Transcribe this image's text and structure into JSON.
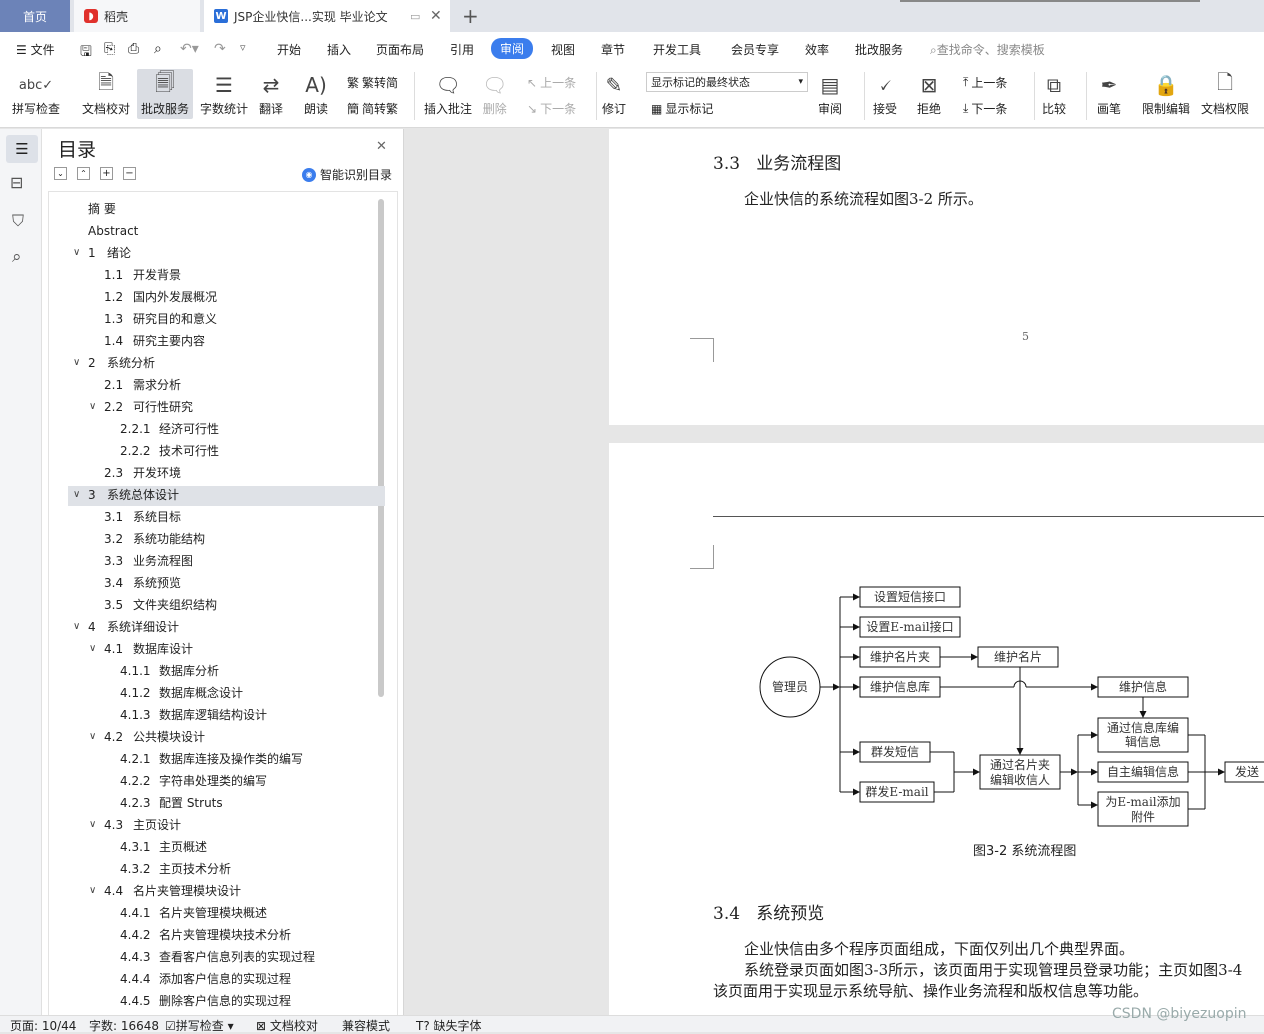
{
  "tabs": {
    "home": "首页",
    "wps": "稻壳",
    "doc": "JSP企业快信...实现 毕业论文"
  },
  "menu": {
    "file": "文件",
    "items": [
      "开始",
      "插入",
      "页面布局",
      "引用",
      "审阅",
      "视图",
      "章节",
      "开发工具",
      "会员专享",
      "效率",
      "批改服务"
    ],
    "active": "审阅",
    "search": "查找命令、搜索模板"
  },
  "ribbon": {
    "spellcheck": "拼写检查",
    "doc_check": "文档校对",
    "review_service": "批改服务",
    "word_count": "字数统计",
    "translate": "翻译",
    "read_aloud": "朗读",
    "trad_to_simp": "繁转简",
    "simp_to_trad": "简转繁",
    "insert_comment": "插入批注",
    "delete": "删除",
    "prev": "上一条",
    "next": "下一条",
    "revise": "修订",
    "markup_state": "显示标记的最终状态",
    "show_markup": "显示标记",
    "review": "审阅",
    "accept": "接受",
    "reject": "拒绝",
    "prev2": "上一条",
    "next2": "下一条",
    "compare": "比较",
    "pen": "画笔",
    "restrict_edit": "限制编辑",
    "doc_permission": "文档权限"
  },
  "nav": {
    "title": "目录",
    "smart_toc": "智能识别目录",
    "items": [
      {
        "num": "",
        "text": "摘  要",
        "level": 0,
        "expand": ""
      },
      {
        "num": "",
        "text": "Abstract",
        "level": 0,
        "expand": ""
      },
      {
        "num": "1",
        "text": "绪论",
        "level": 1,
        "expand": "v"
      },
      {
        "num": "1.1",
        "text": "开发背景",
        "level": 2,
        "expand": ""
      },
      {
        "num": "1.2",
        "text": "国内外发展概况",
        "level": 2,
        "expand": ""
      },
      {
        "num": "1.3",
        "text": "研究目的和意义",
        "level": 2,
        "expand": ""
      },
      {
        "num": "1.4",
        "text": "研究主要内容",
        "level": 2,
        "expand": ""
      },
      {
        "num": "2",
        "text": "系统分析",
        "level": 1,
        "expand": "v"
      },
      {
        "num": "2.1",
        "text": "需求分析",
        "level": 2,
        "expand": ""
      },
      {
        "num": "2.2",
        "text": "可行性研究",
        "level": 2,
        "expand": "v"
      },
      {
        "num": "2.2.1",
        "text": "经济可行性",
        "level": 3,
        "expand": ""
      },
      {
        "num": "2.2.2",
        "text": "技术可行性",
        "level": 3,
        "expand": ""
      },
      {
        "num": "2.3",
        "text": "开发环境",
        "level": 2,
        "expand": ""
      },
      {
        "num": "3",
        "text": "系统总体设计",
        "level": 1,
        "expand": "v",
        "selected": true
      },
      {
        "num": "3.1",
        "text": "系统目标",
        "level": 2,
        "expand": ""
      },
      {
        "num": "3.2",
        "text": "系统功能结构",
        "level": 2,
        "expand": ""
      },
      {
        "num": "3.3",
        "text": "业务流程图",
        "level": 2,
        "expand": ""
      },
      {
        "num": "3.4",
        "text": "系统预览",
        "level": 2,
        "expand": ""
      },
      {
        "num": "3.5",
        "text": "文件夹组织结构",
        "level": 2,
        "expand": ""
      },
      {
        "num": "4",
        "text": "系统详细设计",
        "level": 1,
        "expand": "v"
      },
      {
        "num": "4.1",
        "text": "数据库设计",
        "level": 2,
        "expand": "v"
      },
      {
        "num": "4.1.1",
        "text": "数据库分析",
        "level": 3,
        "expand": ""
      },
      {
        "num": "4.1.2",
        "text": "数据库概念设计",
        "level": 3,
        "expand": ""
      },
      {
        "num": "4.1.3",
        "text": "数据库逻辑结构设计",
        "level": 3,
        "expand": ""
      },
      {
        "num": "4.2",
        "text": "公共模块设计",
        "level": 2,
        "expand": "v"
      },
      {
        "num": "4.2.1",
        "text": "数据库连接及操作类的编写",
        "level": 3,
        "expand": ""
      },
      {
        "num": "4.2.2",
        "text": "字符串处理类的编写",
        "level": 3,
        "expand": ""
      },
      {
        "num": "4.2.3",
        "text": "配置 Struts",
        "level": 3,
        "expand": ""
      },
      {
        "num": "4.3",
        "text": "主页设计",
        "level": 2,
        "expand": "v"
      },
      {
        "num": "4.3.1",
        "text": "主页概述",
        "level": 3,
        "expand": ""
      },
      {
        "num": "4.3.2",
        "text": "主页技术分析",
        "level": 3,
        "expand": ""
      },
      {
        "num": "4.4",
        "text": "名片夹管理模块设计",
        "level": 2,
        "expand": "v"
      },
      {
        "num": "4.4.1",
        "text": "名片夹管理模块概述",
        "level": 3,
        "expand": ""
      },
      {
        "num": "4.4.2",
        "text": "名片夹管理模块技术分析",
        "level": 3,
        "expand": ""
      },
      {
        "num": "4.4.3",
        "text": "查看客户信息列表的实现过程",
        "level": 3,
        "expand": ""
      },
      {
        "num": "4.4.4",
        "text": "添加客户信息的实现过程",
        "level": 3,
        "expand": ""
      },
      {
        "num": "4.4.5",
        "text": "删除客户信息的实现过程",
        "level": 3,
        "expand": ""
      }
    ]
  },
  "document": {
    "sec33_num": "3.3",
    "sec33_title": "业务流程图",
    "sec33_body": "企业快信的系统流程如图3-2 所示。",
    "page_number": "5",
    "fig_caption": "图3-2  系统流程图",
    "sec34_num": "3.4",
    "sec34_title": "系统预览",
    "sec34_p1": "企业快信由多个程序页面组成，下面仅列出几个典型界面。",
    "sec34_p2": "系统登录页面如图3-3所示，该页面用于实现管理员登录功能；主页如图3-4",
    "sec34_p3": "该页面用于实现显示系统导航、操作业务流程和版权信息等功能。",
    "flow": {
      "admin": "管理员",
      "set_sms": "设置短信接口",
      "set_email": "设置E-mail接口",
      "maintain_folder": "维护名片夹",
      "maintain_card": "维护名片",
      "maintain_lib": "维护信息库",
      "maintain_info": "维护信息",
      "via_lib_1": "通过信息库编",
      "via_lib_2": "辑信息",
      "group_sms": "群发短信",
      "edit_recv_1": "通过名片夹",
      "edit_recv_2": "编辑收信人",
      "self_edit": "自主编辑信息",
      "group_email": "群发E-mail",
      "attach_1": "为E-mail添加",
      "attach_2": "附件",
      "send": "发送"
    }
  },
  "status": {
    "page": "页面: 10/44",
    "words": "字数: 16648",
    "spell": "拼写检查",
    "doc_check": "文档校对",
    "compat": "兼容模式",
    "missing_font": "缺失字体",
    "watermark": "CSDN @biyezuopin"
  }
}
